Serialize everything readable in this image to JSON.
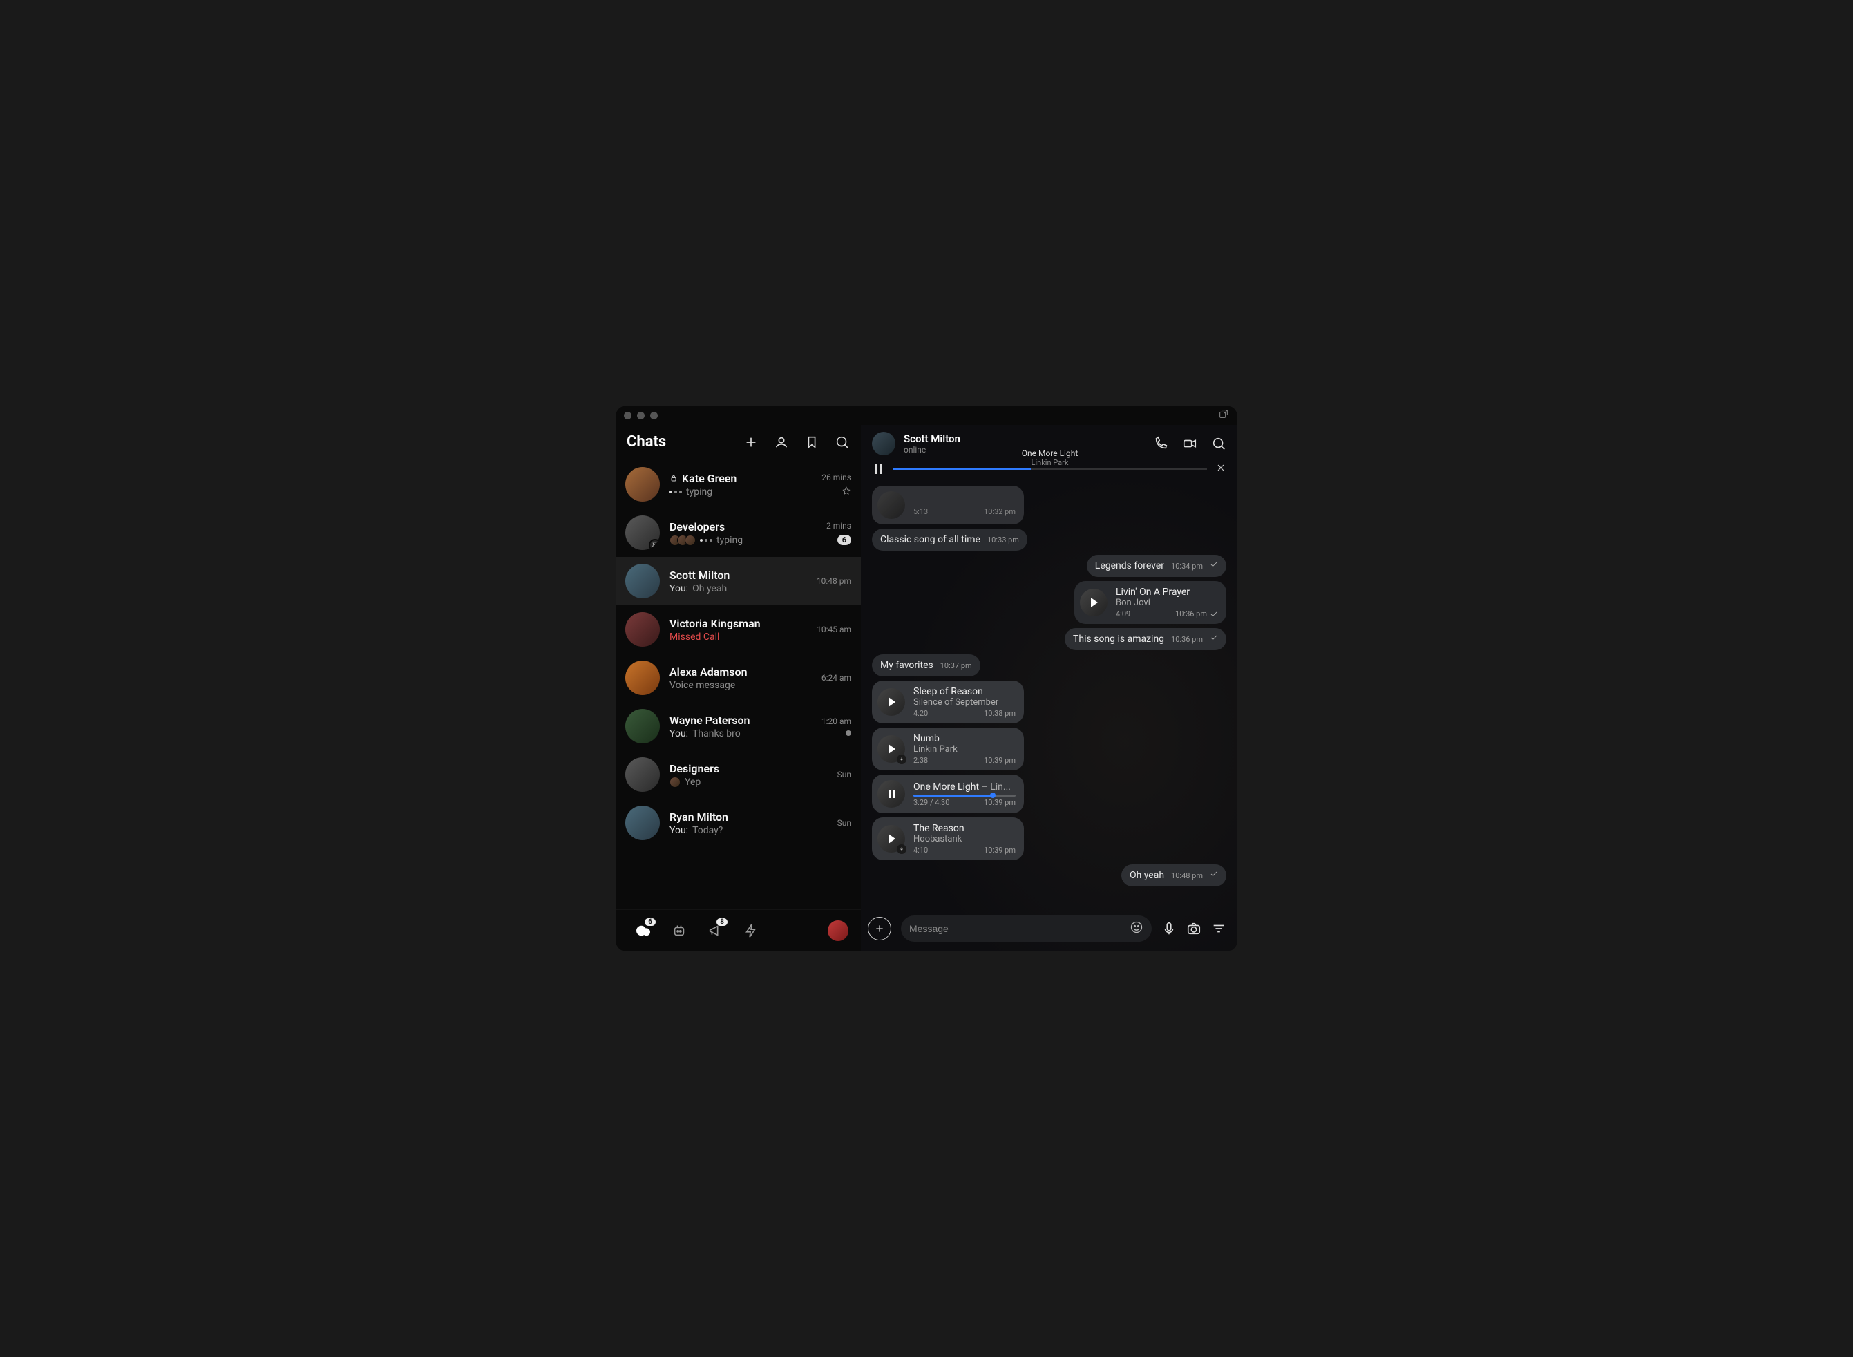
{
  "sidebar": {
    "title": "Chats",
    "chats": [
      {
        "name": "Kate Green",
        "locked": true,
        "typing": true,
        "typing_label": "typing",
        "time": "26 mins",
        "pinned": true
      },
      {
        "name": "Developers",
        "typing": true,
        "typing_label": "typing",
        "time": "2 mins",
        "count": "6",
        "group_typers": 3,
        "muted": true
      },
      {
        "name": "Scott Milton",
        "you": "You:",
        "preview": "Oh yeah",
        "time": "10:48 pm",
        "active": true
      },
      {
        "name": "Victoria Kingsman",
        "missed": "Missed Call",
        "time": "10:45 am"
      },
      {
        "name": "Alexa Adamson",
        "preview": "Voice message",
        "time": "6:24 am"
      },
      {
        "name": "Wayne Paterson",
        "you": "You:",
        "preview": "Thanks bro",
        "time": "1:20 am",
        "seen_dot": true
      },
      {
        "name": "Designers",
        "preview": "Yep",
        "time": "Sun",
        "group_single": true
      },
      {
        "name": "Ryan Milton",
        "you": "You:",
        "preview": "Today?",
        "time": "Sun"
      }
    ],
    "bottom": {
      "chats_badge": "6",
      "broadcast_badge": "8"
    }
  },
  "conversation": {
    "title": "Scott Milton",
    "status": "online",
    "now_playing": {
      "title": "One More Light",
      "artist": "Linkin Park"
    },
    "messages": [
      {
        "kind": "song_stub",
        "side": "in",
        "duration": "5:13",
        "time": "10:32 pm"
      },
      {
        "kind": "text",
        "side": "in",
        "text": "Classic song of all time",
        "time": "10:33 pm"
      },
      {
        "kind": "text",
        "side": "out",
        "text": "Legends forever",
        "time": "10:34 pm",
        "check": true
      },
      {
        "kind": "song",
        "side": "out",
        "title": "Livin' On A Prayer",
        "artist": "Bon Jovi",
        "duration": "4:09",
        "time": "10:36 pm",
        "check": true
      },
      {
        "kind": "text",
        "side": "out",
        "text": "This song is amazing",
        "time": "10:36 pm",
        "check": true
      },
      {
        "kind": "text",
        "side": "in",
        "text": "My favorites",
        "time": "10:37 pm"
      },
      {
        "kind": "song",
        "side": "in",
        "title": "Sleep of Reason",
        "artist": "Silence of September",
        "duration": "4:20",
        "time": "10:38 pm"
      },
      {
        "kind": "song",
        "side": "in",
        "title": "Numb",
        "artist": "Linkin Park",
        "duration": "2:38",
        "time": "10:39 pm",
        "download": true
      },
      {
        "kind": "song_playing",
        "side": "in",
        "title": "One More Light – ",
        "artist_inline": "Lin...",
        "elapsed": "3:29 / 4:30",
        "time": "10:39 pm"
      },
      {
        "kind": "song",
        "side": "in",
        "title": "The Reason",
        "artist": "Hoobastank",
        "duration": "4:10",
        "time": "10:39 pm",
        "download": true
      },
      {
        "kind": "text",
        "side": "out",
        "text": "Oh yeah",
        "time": "10:48 pm",
        "check": true
      }
    ],
    "composer": {
      "placeholder": "Message"
    }
  }
}
